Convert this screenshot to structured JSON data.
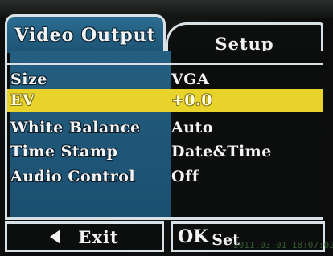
{
  "tabs": [
    {
      "label": "Video Output",
      "active": true
    },
    {
      "label": "Setup",
      "active": false
    }
  ],
  "settings": [
    {
      "label": "Size",
      "value": "VGA",
      "selected": false
    },
    {
      "label": "EV",
      "value": "+0.0",
      "selected": true
    },
    {
      "label": "White Balance",
      "value": "Auto",
      "selected": false
    },
    {
      "label": "Time Stamp",
      "value": "Date&Time",
      "selected": false
    },
    {
      "label": "Audio Control",
      "value": "Off",
      "selected": false
    }
  ],
  "footer": {
    "exit_label": "Exit",
    "ok_label": "OK",
    "set_label": "Set",
    "exit_icon": "left-triangle-icon"
  },
  "overlay_timestamp": "2011.03.01 18:07:02",
  "colors": {
    "active_tab": "#1d5375",
    "highlight": "#e8d32a",
    "border": "#d8e2e6",
    "background": "#0c0e0d"
  }
}
